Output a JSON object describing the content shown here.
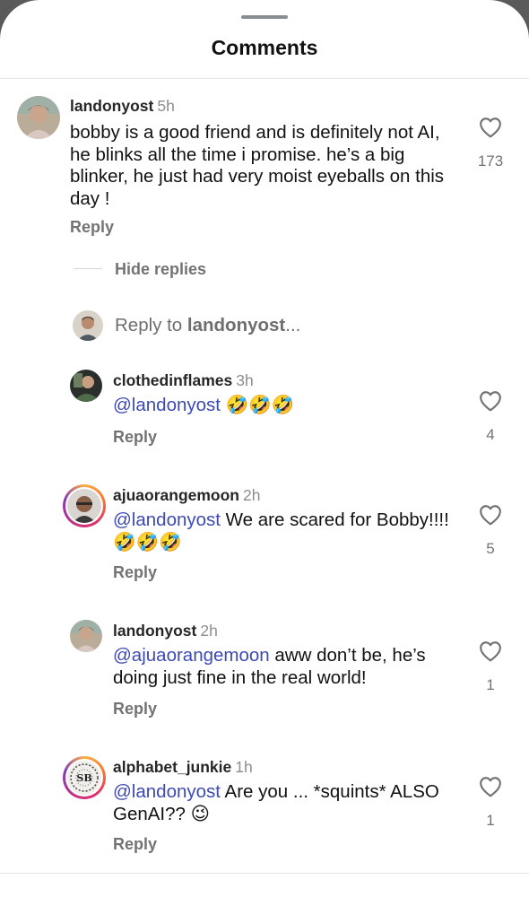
{
  "sheet": {
    "title": "Comments"
  },
  "comments": [
    {
      "username": "landonyost",
      "time": "5h",
      "text": "bobby is a good friend and is definitely not AI, he blinks all the time i promise. he’s a big blinker, he just had very moist eyeballs on this day !",
      "reply_label": "Reply",
      "likes": "173"
    }
  ],
  "thread": {
    "hide_replies_label": "Hide replies",
    "reply_to_prefix": "Reply to ",
    "reply_to_user": "landonyost",
    "reply_to_suffix": "..."
  },
  "replies": [
    {
      "username": "clothedinflames",
      "time": "3h",
      "mention": "@landonyost",
      "text": " 🤣🤣🤣",
      "reply_label": "Reply",
      "likes": "4"
    },
    {
      "username": "ajuaorangemoon",
      "time": "2h",
      "mention": "@landonyost",
      "text": " We are scared for Bobby!!!! 🤣🤣🤣",
      "reply_label": "Reply",
      "likes": "5"
    },
    {
      "username": "landonyost",
      "time": "2h",
      "mention": "@ajuaorangemoon",
      "text": " aww don’t be, he’s doing just fine in the real world!",
      "reply_label": "Reply",
      "likes": "1"
    },
    {
      "username": "alphabet_junkie",
      "time": "1h",
      "mention": "@landonyost",
      "text": " Are you ... *squints* ALSO GenAI?? 😉",
      "reply_label": "Reply",
      "likes": "1"
    }
  ],
  "icons": {
    "like": "heart-outline-icon"
  },
  "colors": {
    "mention": "#3d4ab3",
    "muted": "#737373",
    "story_ring": "#e1306c"
  }
}
